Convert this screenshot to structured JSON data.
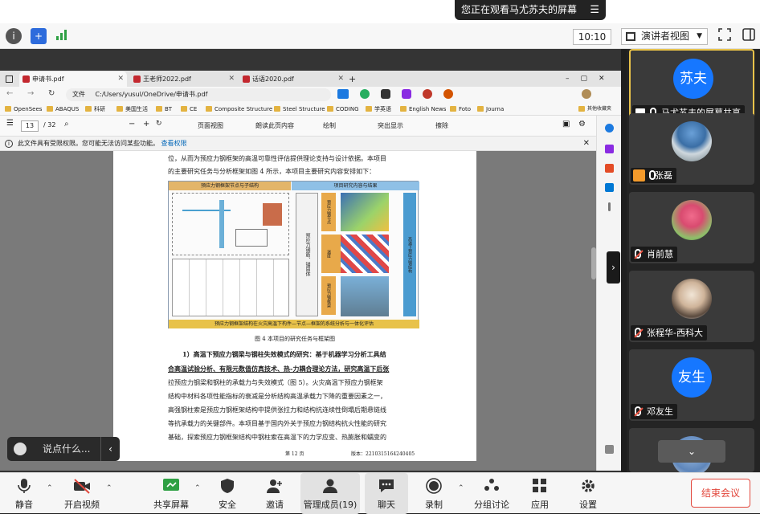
{
  "banner": {
    "text": "您正在观看马尤苏夫的屏幕",
    "menu_glyph": "☰"
  },
  "topbar": {
    "time": "10:10",
    "view_mode": "演讲者视图"
  },
  "browser": {
    "tabs": [
      {
        "label": "申请书.pdf",
        "active": true
      },
      {
        "label": "王老师2022.pdf",
        "active": false
      },
      {
        "label": "话语2020.pdf",
        "active": false
      }
    ],
    "address": {
      "prefix": "文件",
      "url": "C:/Users/yusul/OneDrive/申请书.pdf"
    },
    "bookmarks": [
      "OpenSees",
      "ABAQUS",
      "科研",
      "美国生活",
      "BT",
      "CE",
      "Composite Structure",
      "Steel Structure",
      "CODING",
      "学英语",
      "English News",
      "Foto",
      "Journa"
    ],
    "bookmarks_other": "其他收藏夹",
    "pdf_toolbar": {
      "page": "13",
      "pages": "/ 32",
      "page_view": "页面视图",
      "read_aloud": "朗读此页内容",
      "draw": "绘制",
      "highlight": "突出显示",
      "erase": "擦除"
    },
    "notice": {
      "text": "此文件具有受限权限。您可能无法访问某些功能。",
      "link": "查看权限"
    }
  },
  "document": {
    "line1": "位，从而为预应力钢框架的高温可靠性评估提供理论支持与设计依据。本项目",
    "line2": "的主要研究任务与分析框架如图 4 所示，本项目主要研究内容安排如下：",
    "fig_left_title": "预应力钢框架节点与子结构",
    "fig_right_title": "项目研究内容与结果",
    "fig_mid": [
      "预应力钢节点",
      "高温下预应力钢结构"
    ],
    "fig_col_labels": [
      "预应力钢筋、锚固体",
      "材料、钢筋、应力、温度",
      "预应力钢框架"
    ],
    "fig_bottom": "预应力钢框架结构在火灾高温下构件—节点—框架的系统分析与一体化评估",
    "fig_caption": "图 4 本项目的研究任务与框架图",
    "para1": "1）高温下预应力钢梁与钢柱失效模式的研究：基于机器学习分析工具结",
    "para2": "合高温试验分析、有限元数值仿真技术、热-力耦合理论方法，研究高温下后张",
    "para3": "拉预应力钢梁和钢柱的承载力与失效模式（图 5）。火灾高温下预应力钢框架",
    "para4": "结构中材料各项性能指标的衰减是分析结构高温承载力下降的重要因素之一，",
    "para5": "高强钢柱索是预应力钢框架结构中提供张拉力和结构抗连续性倒塌后期悬链线",
    "para6": "等抗承载力的关键部件。本项目基于国内外关于预应力钢结构抗火性能的研究",
    "para7": "基础，探索预应力钢框架结构中钢柱索在高温下的力学应变、热膨胀和蠕变的",
    "footer_page": "第 12 页",
    "footer_version": "版本：2210315164240405"
  },
  "comment": {
    "placeholder": "说点什么..."
  },
  "participants": [
    {
      "name": "马尤苏夫的屏幕共享",
      "avatar_text": "苏夫",
      "kind": "share"
    },
    {
      "name": "张磊",
      "avatar_text": "",
      "kind": "user"
    },
    {
      "name": "肖前慧",
      "avatar_text": "",
      "kind": "muted"
    },
    {
      "name": "张程华-西科大",
      "avatar_text": "",
      "kind": "muted"
    },
    {
      "name": "邓友生",
      "avatar_text": "友生",
      "kind": "muted"
    }
  ],
  "toolbar": {
    "mute": "静音",
    "video": "开启视频",
    "share": "共享屏幕",
    "security": "安全",
    "invite": "邀请",
    "members": "管理成员(19)",
    "chat": "聊天",
    "record": "录制",
    "breakout": "分组讨论",
    "apps": "应用",
    "settings": "设置",
    "end": "结束会议"
  },
  "colors": {
    "accent": "#1677ff",
    "end": "#e2483d",
    "active_border": "#e8c24a"
  }
}
